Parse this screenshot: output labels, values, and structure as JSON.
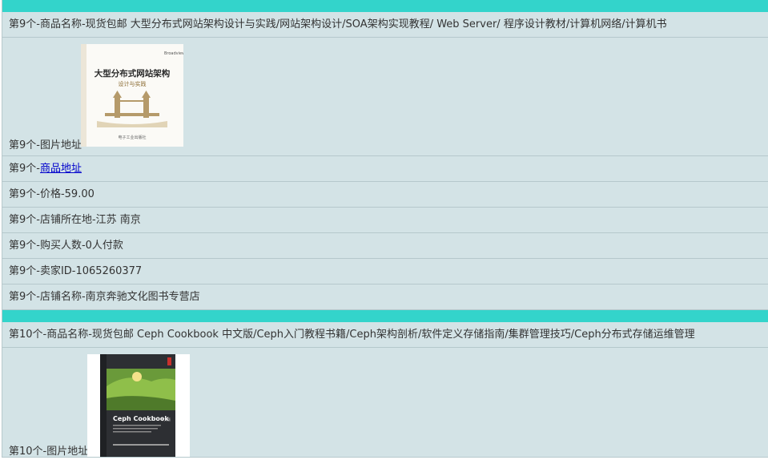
{
  "items": [
    {
      "name_text": "第9个-商品名称-现货包邮 大型分布式网站架构设计与实践/网站架构设计/SOA架构实现教程/ Web Server/ 程序设计教材/计算机网络/计算机书",
      "image_label": "第9个-图片地址-",
      "book_title": "大型分布式网站架构",
      "book_subtitle": "设计与实践",
      "link_prefix": "第9个-",
      "link_text": "商品地址",
      "price_text": "第9个-价格-59.00",
      "location_text": "第9个-店铺所在地-江苏 南京",
      "buyers_text": "第9个-购买人数-0人付款",
      "seller_text": "第9个-卖家ID-1065260377",
      "shop_text": "第9个-店铺名称-南京奔驰文化图书专营店"
    },
    {
      "name_text": "第10个-商品名称-现货包邮 Ceph Cookbook 中文版/Ceph入门教程书籍/Ceph架构剖析/软件定义存储指南/集群管理技巧/Ceph分布式存储运维管理",
      "image_label": "第10个-图片地址-",
      "book_title": "Ceph Cookbook",
      "book_subtitle": "中文版"
    }
  ],
  "colors": {
    "separator": "#33d4cb",
    "row_bg": "#d3e3e6",
    "link": "#0000cc"
  }
}
